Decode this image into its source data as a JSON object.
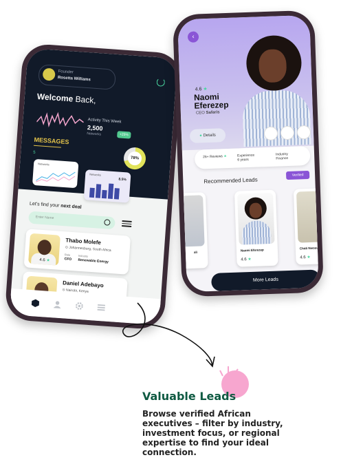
{
  "left_phone": {
    "profile_role": "Founder",
    "profile_name": "Rosetta Williams",
    "welcome_bold": "Welcome",
    "welcome_rest": "Back,",
    "activity_label": "Activity This Week",
    "activity_value": "2,500",
    "activity_sub": "Networks",
    "activity_badge": "+25%",
    "messages_label": "MESSAGES",
    "messages_count": "5",
    "donut_label": "78%",
    "donut_fraction": 0.78,
    "card_a_title": "Networks",
    "card_b_title": "Networks",
    "card_b_value": "8.5%",
    "find_deal_text": "Let's find your",
    "find_deal_bold": "next deal",
    "search_placeholder": "Enter Name",
    "leads": [
      {
        "name": "Thabo Molefe",
        "location": "Johannesburg, South Africa",
        "rating": "4.6",
        "role_label": "Role",
        "role": "CFO",
        "industry_label": "Industry",
        "industry": "Renewable Energy"
      },
      {
        "name": "Daniel Adebayo",
        "location": "Nairobi, Kenya",
        "rating": "",
        "role_label": "Role",
        "role": "",
        "industry_label": "Industry",
        "industry": ""
      }
    ]
  },
  "right_phone": {
    "rating": "4.6",
    "name_first": "Naomi",
    "name_last": "Eferezep",
    "role": "CEO",
    "company": "Safaris",
    "details_tab": "Details",
    "stats": [
      {
        "label": "26+ Reviews"
      },
      {
        "label": "Experience",
        "sub": "6 years"
      },
      {
        "label": "Industry",
        "sub": "Finance"
      }
    ],
    "recommended_title": "Recommended Leads",
    "verified_label": "Verified",
    "rec_cards": [
      {
        "name": "ali",
        "rating": ""
      },
      {
        "name": "Naomi Eferezep",
        "rating": "4.6"
      },
      {
        "name": "Chidi Nwosu",
        "rating": "4.6"
      }
    ],
    "more_leads_label": "More Leads"
  },
  "feature": {
    "headline": "Valuable Leads",
    "description": "Browse verified African executives – filter by industry, investment focus, or regional expertise to find your ideal connection."
  },
  "colors": {
    "dark_navy": "#111a29",
    "mint": "#4ad7a0",
    "purple": "#8a55d6",
    "headline_green": "#0f5a42",
    "pink": "#f7a6cf"
  }
}
